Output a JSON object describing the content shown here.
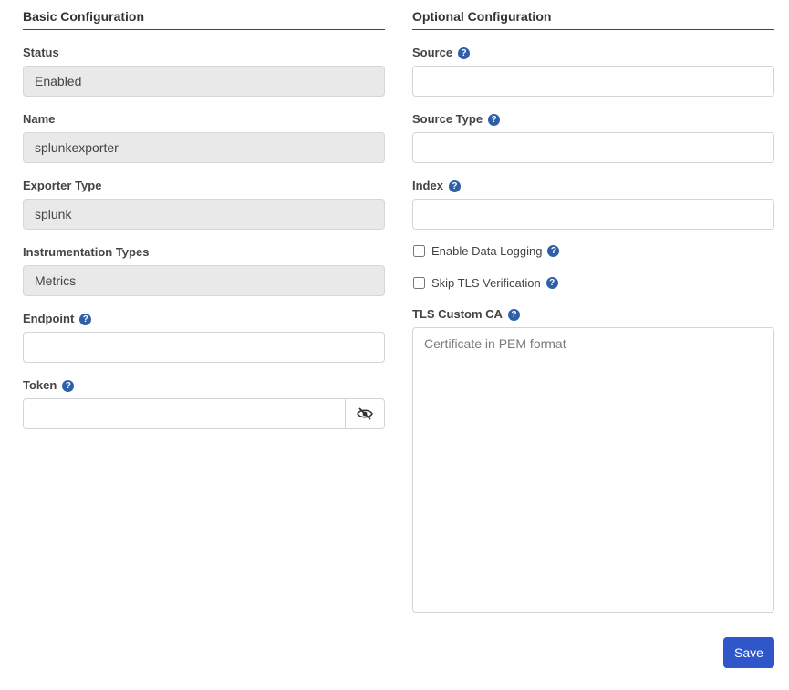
{
  "basic": {
    "title": "Basic Configuration",
    "status_label": "Status",
    "status_value": "Enabled",
    "name_label": "Name",
    "name_value": "splunkexporter",
    "exporter_type_label": "Exporter Type",
    "exporter_type_value": "splunk",
    "instrumentation_label": "Instrumentation Types",
    "instrumentation_value": "Metrics",
    "endpoint_label": "Endpoint",
    "endpoint_value": "",
    "token_label": "Token",
    "token_value": ""
  },
  "optional": {
    "title": "Optional Configuration",
    "source_label": "Source",
    "source_value": "",
    "source_type_label": "Source Type",
    "source_type_value": "",
    "index_label": "Index",
    "index_value": "",
    "enable_logging_label": "Enable Data Logging",
    "enable_logging_checked": false,
    "skip_tls_label": "Skip TLS Verification",
    "skip_tls_checked": false,
    "tls_ca_label": "TLS Custom CA",
    "tls_ca_placeholder": "Certificate in PEM format"
  },
  "help_glyph": "?",
  "icons": {
    "help": "question-circle-icon",
    "toggle_visibility": "eye-slash-icon"
  },
  "colors": {
    "accent": "#3057c9",
    "help": "#2f5fa8",
    "divider": "#2c4a73",
    "readonly_bg": "#e9e9e9"
  },
  "save_label": "Save"
}
